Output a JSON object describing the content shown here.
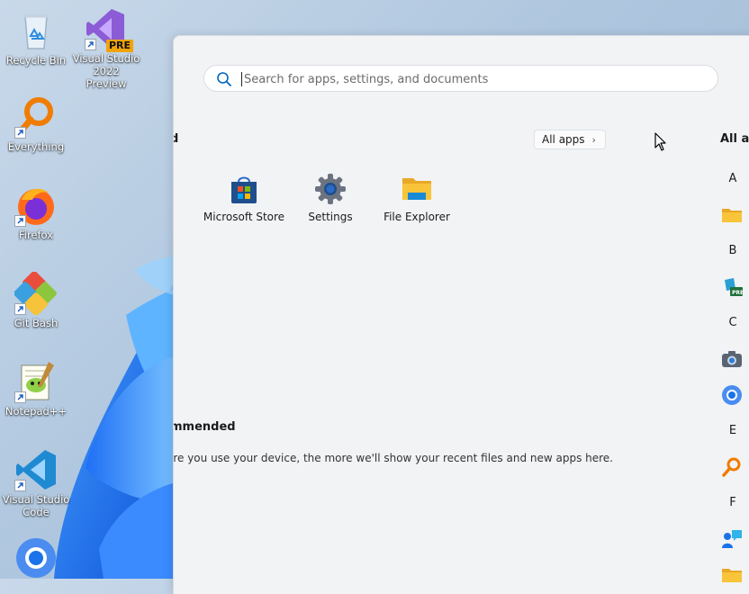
{
  "desktop": {
    "icons": [
      {
        "label": "Recycle Bin",
        "icon": "recycle-bin-icon"
      },
      {
        "label": "Visual Studio 2022 Preview",
        "icon": "visual-studio-preview-icon",
        "badge": "PRE"
      },
      {
        "label": "Everything",
        "icon": "everything-search-icon"
      },
      {
        "label": "Firefox",
        "icon": "firefox-icon"
      },
      {
        "label": "Git Bash",
        "icon": "git-bash-icon"
      },
      {
        "label": "Notepad++",
        "icon": "notepad-plus-plus-icon"
      },
      {
        "label": "Visual Studio Code",
        "icon": "vscode-icon"
      },
      {
        "label": "",
        "icon": "chrome-icon"
      }
    ]
  },
  "start_menu": {
    "search": {
      "placeholder": "Search for apps, settings, and documents",
      "value": ""
    },
    "pinned": {
      "title_partial": "d",
      "all_apps_label": "All apps",
      "apps": [
        {
          "label": "Microsoft Store",
          "icon": "microsoft-store-icon"
        },
        {
          "label": "Settings",
          "icon": "settings-gear-icon"
        },
        {
          "label": "File Explorer",
          "icon": "file-explorer-icon"
        }
      ]
    },
    "recommended": {
      "title_partial": "mmended",
      "empty_text_partial": "ore you use your device, the more we'll show your recent files and new apps here."
    },
    "all_apps_panel": {
      "title_partial": "All ap",
      "letters": [
        "A",
        "B",
        "C",
        "E",
        "F"
      ],
      "icons": [
        "folder-icon",
        "visual-studio-installer-icon",
        "camera-icon",
        "chrome-icon",
        "everything-search-icon",
        "feedback-hub-icon",
        "folder-icon"
      ]
    }
  },
  "colors": {
    "accent": "#0067c0",
    "panel_bg": "#f1f3f5",
    "folder": "#f8c43a"
  }
}
